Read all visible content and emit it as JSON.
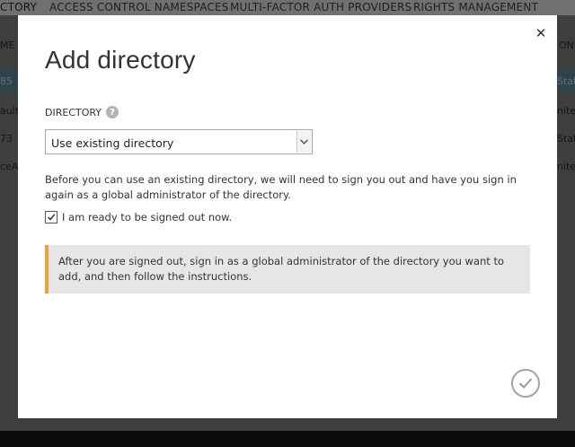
{
  "background": {
    "nav": [
      "CTORY",
      "ACCESS CONTROL NAMESPACES",
      "MULTI-FACTOR AUTH PROVIDERS",
      "RIGHTS MANAGEMENT"
    ],
    "header_left": "ME",
    "header_right": "ON",
    "rows": [
      {
        "left": "85",
        "right": "Stat"
      },
      {
        "left": "ault",
        "right": "nite"
      },
      {
        "left": "73",
        "right": "Stat"
      },
      {
        "left": "ceA",
        "right": "nite"
      }
    ]
  },
  "modal": {
    "close_glyph": "✕",
    "title": "Add directory",
    "directory_label": "DIRECTORY",
    "help_glyph": "?",
    "select_value": "Use existing directory",
    "description": "Before you can use an existing directory, we will need to sign you out and have you sign in again as a global administrator of the directory.",
    "checkbox_label": "I am ready to be signed out now.",
    "checkbox_checked": true,
    "info_text": "After you are signed out, sign in as a global administrator of the directory you want to add, and then follow the instructions."
  },
  "colors": {
    "info_accent": "#e8a33c",
    "selected_row": "#5d7f93"
  }
}
